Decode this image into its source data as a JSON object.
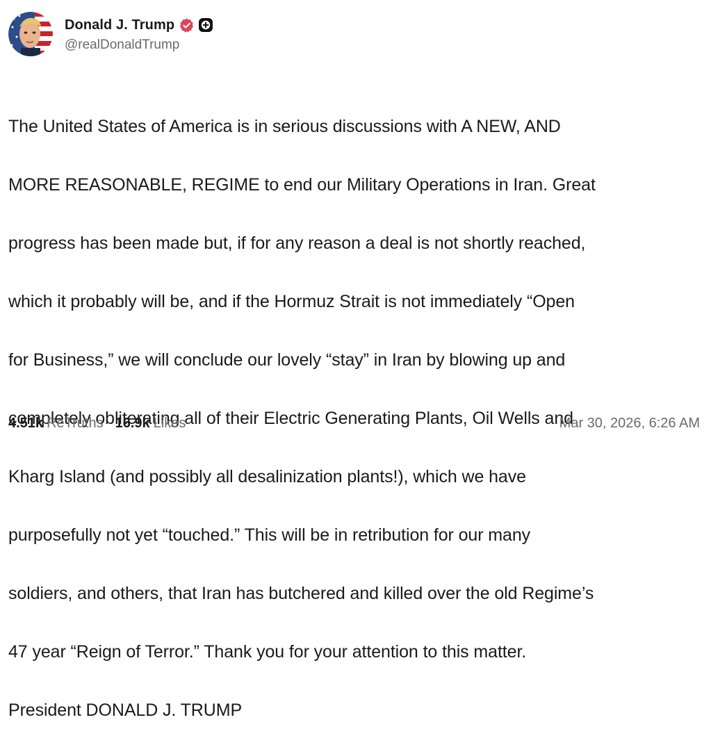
{
  "author": {
    "display_name": "Donald J. Trump",
    "handle": "@realDonaldTrump",
    "avatar_icon": "avatar-portrait-flag",
    "verified_color": "#e0445c"
  },
  "post": {
    "lines": [
      "The United States of America is in serious discussions with A NEW, AND",
      "MORE REASONABLE, REGIME to end our Military Operations in Iran. Great",
      "progress has been made but, if for any reason a deal is not shortly reached,",
      "which it probably will be, and if the Hormuz Strait is not immediately “Open",
      "for Business,” we will conclude our lovely “stay” in Iran by blowing up and",
      "completely obliterating all of their Electric Generating Plants, Oil Wells and",
      "Kharg Island (and possibly all desalinization plants!), which we have",
      "purposefully not yet “touched.” This will be in retribution for our many",
      "soldiers, and others, that Iran has butchered and killed over the old Regime’s",
      "47 year “Reign of Terror.” Thank you for your attention to this matter.",
      "President DONALD J. TRUMP"
    ]
  },
  "stats": {
    "retruths_count": "4.51k",
    "retruths_label": "ReTruths",
    "likes_count": "16.9k",
    "likes_label": "Likes"
  },
  "timestamp": "Mar 30, 2026, 6:26 AM"
}
